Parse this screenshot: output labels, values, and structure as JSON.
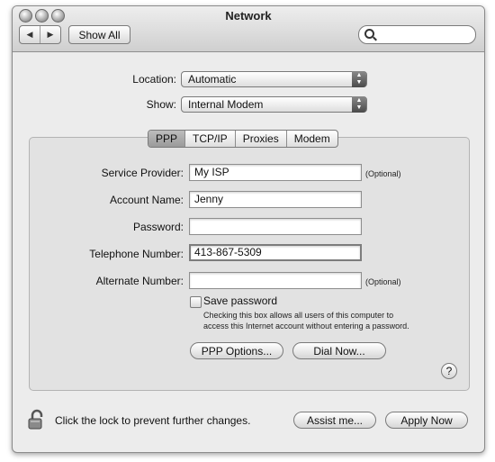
{
  "window": {
    "title": "Network"
  },
  "toolbar": {
    "back_icon": "back-arrow-icon",
    "forward_icon": "forward-arrow-icon",
    "show_all_label": "Show All",
    "search_placeholder": ""
  },
  "location": {
    "label": "Location:",
    "value": "Automatic"
  },
  "show": {
    "label": "Show:",
    "value": "Internal Modem"
  },
  "tabs": [
    {
      "label": "PPP",
      "active": true
    },
    {
      "label": "TCP/IP",
      "active": false
    },
    {
      "label": "Proxies",
      "active": false
    },
    {
      "label": "Modem",
      "active": false
    }
  ],
  "form": {
    "service_provider": {
      "label": "Service Provider:",
      "value": "My ISP",
      "note": "(Optional)"
    },
    "account_name": {
      "label": "Account Name:",
      "value": "Jenny"
    },
    "password": {
      "label": "Password:",
      "value": ""
    },
    "telephone_number": {
      "label": "Telephone Number:",
      "value": "413-867-5309"
    },
    "alternate_number": {
      "label": "Alternate Number:",
      "value": "",
      "note": "(Optional)"
    },
    "save_password": {
      "label": "Save password",
      "checked": false,
      "help_line1": "Checking this box allows all users of this computer to",
      "help_line2": "access this Internet account without entering a password."
    }
  },
  "buttons": {
    "ppp_options": "PPP Options...",
    "dial_now": "Dial Now...",
    "help": "?",
    "assist_me": "Assist me...",
    "apply_now": "Apply Now"
  },
  "footer": {
    "lock_text": "Click the lock to prevent further changes.",
    "lock_icon": "lock-icon"
  }
}
